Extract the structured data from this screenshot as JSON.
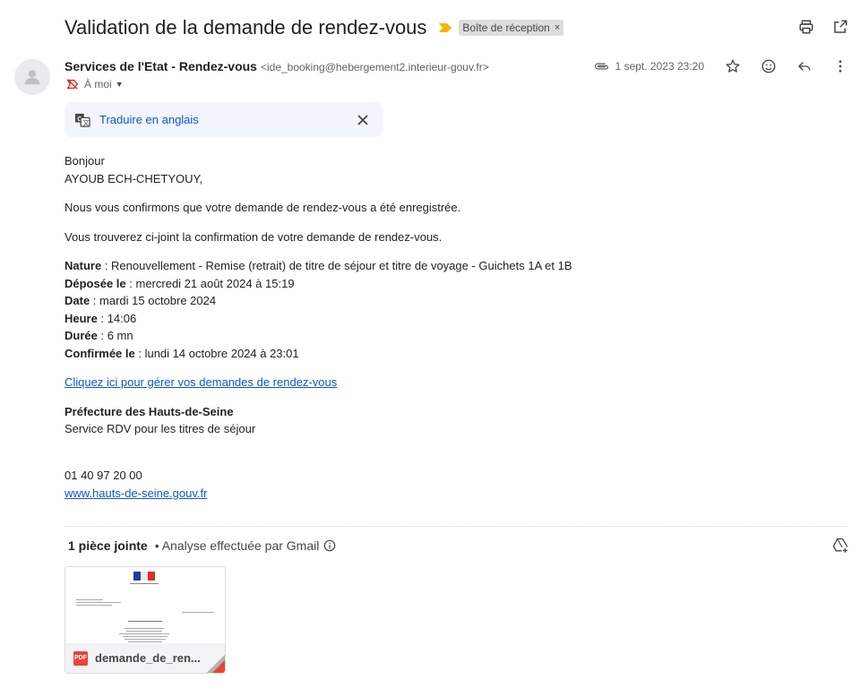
{
  "email": {
    "subject": "Validation de la demande de rendez-vous",
    "label": "Boîte de réception",
    "label_remove": "×",
    "sender_name": "Services de l'Etat - Rendez-vous",
    "sender_email": "<ide_booking@hebergement2.interieur-gouv.fr>",
    "to": "À moi",
    "date": "1 sept. 2023 23:20"
  },
  "translate": {
    "label": "Traduire en anglais"
  },
  "body": {
    "greeting": "Bonjour",
    "name": "AYOUB ECH-CHETYOUY,",
    "para1": "Nous vous confirmons que votre demande de rendez-vous a été enregistrée.",
    "para2": "Vous trouverez ci-joint la confirmation de votre demande de rendez-vous.",
    "details": [
      {
        "label": "Nature",
        "value": " : Renouvellement - Remise (retrait) de titre de séjour et titre de voyage - Guichets 1A et 1B"
      },
      {
        "label": "Déposée le",
        "value": " : mercredi 21 août 2024 à 15:19"
      },
      {
        "label": "Date",
        "value": " : mardi 15 octobre 2024"
      },
      {
        "label": "Heure",
        "value": " : 14:06"
      },
      {
        "label": "Durée",
        "value": " : 6 mn"
      },
      {
        "label": "Confirmée le",
        "value": " : lundi 14 octobre 2024 à 23:01"
      }
    ],
    "manage_link": "Cliquez ici pour gérer vos demandes de rendez-vous",
    "org_name": "Préfecture des Hauts-de-Seine",
    "org_service": "Service RDV pour les titres de séjour",
    "phone": "01 40 97 20 00",
    "website": "www.hauts-de-seine.gouv.fr"
  },
  "attachments": {
    "count_label": "1 pièce jointe",
    "scan_label": "• Analyse effectuée par Gmail",
    "items": [
      {
        "name": "demande_de_ren...",
        "type_badge": "PDF"
      }
    ]
  },
  "colors": {
    "link": "#1155cc",
    "translate_link": "#0b57d0",
    "importance": "#f4b400",
    "pdf": "#ea4335"
  }
}
